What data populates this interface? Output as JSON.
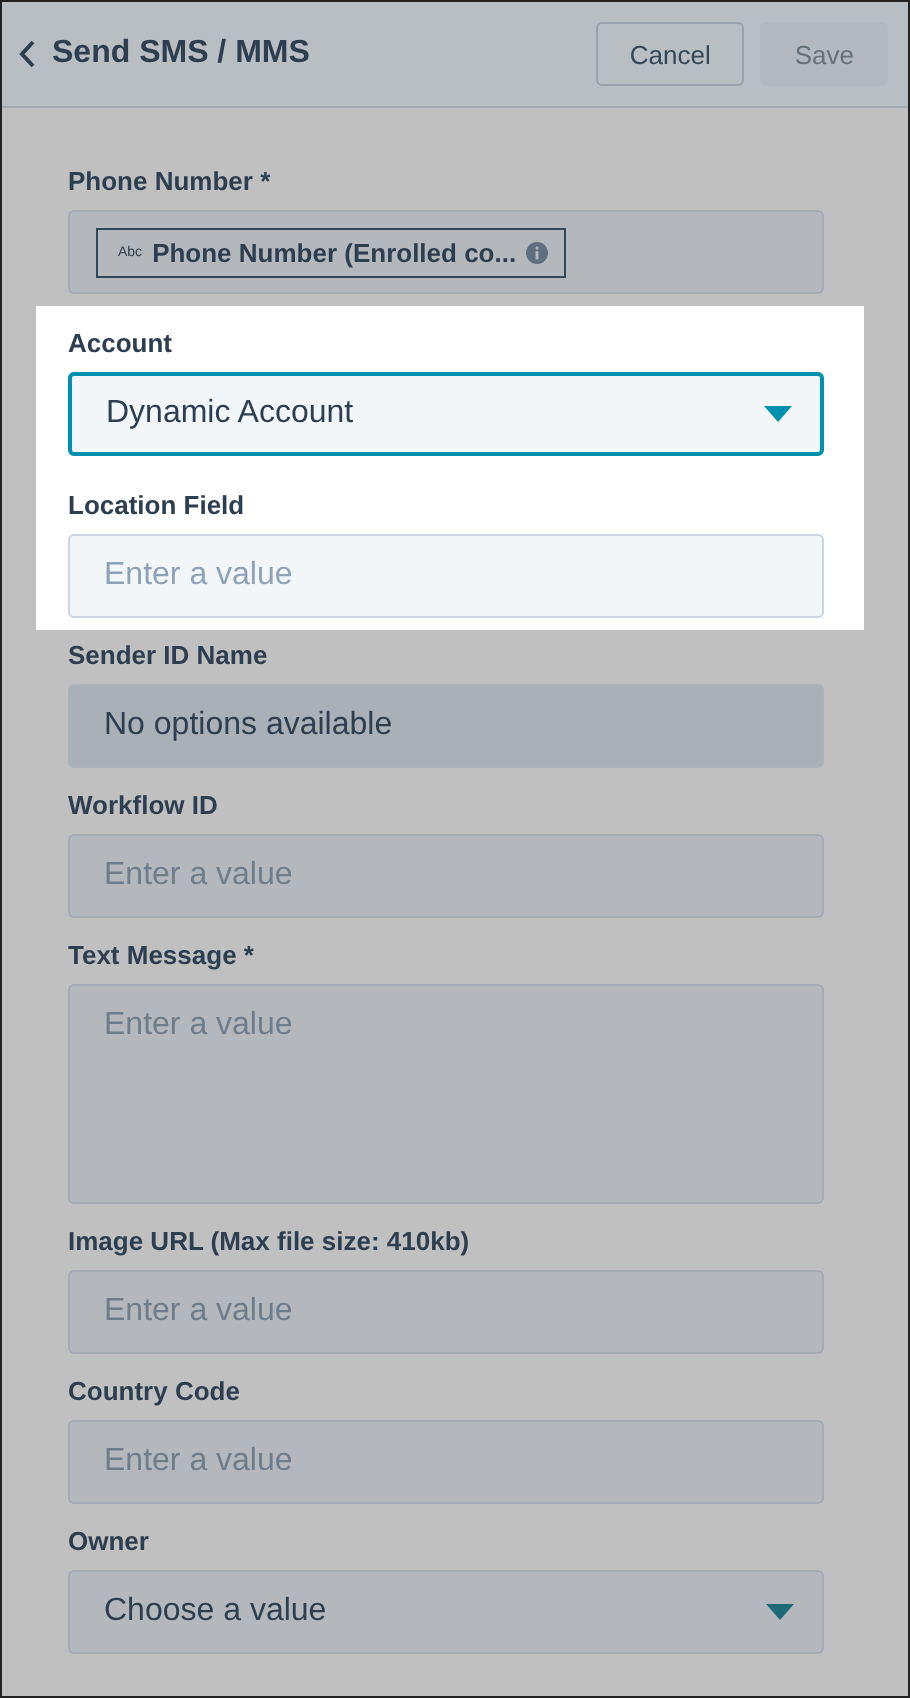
{
  "header": {
    "title": "Send SMS / MMS",
    "buttons": [
      {
        "label": "Cancel",
        "disabled": false
      },
      {
        "label": "Save",
        "disabled": true
      }
    ]
  },
  "fields": [
    {
      "kind": "token",
      "label": "Phone Number *",
      "highlighted": false,
      "token": {
        "type_label": "Abc",
        "text": "Phone Number (Enrolled co..."
      }
    },
    {
      "kind": "select",
      "label": "Account",
      "highlighted": true,
      "focused": true,
      "value": "Dynamic Account"
    },
    {
      "kind": "input",
      "label": "Location Field",
      "highlighted": true,
      "focused": false,
      "placeholder": "Enter a value"
    },
    {
      "kind": "disabled_select",
      "label": "Sender ID Name",
      "highlighted": false,
      "value": "No options available"
    },
    {
      "kind": "input",
      "label": "Workflow ID",
      "highlighted": false,
      "focused": false,
      "placeholder": "Enter a value"
    },
    {
      "kind": "textarea",
      "label": "Text Message *",
      "highlighted": false,
      "focused": false,
      "placeholder": "Enter a value"
    },
    {
      "kind": "input",
      "label": "Image URL (Max file size: 410kb)",
      "highlighted": false,
      "focused": false,
      "placeholder": "Enter a value"
    },
    {
      "kind": "input",
      "label": "Country Code",
      "highlighted": false,
      "focused": false,
      "placeholder": "Enter a value"
    },
    {
      "kind": "select",
      "label": "Owner",
      "highlighted": false,
      "focused": false,
      "value": "Choose a value"
    }
  ]
}
